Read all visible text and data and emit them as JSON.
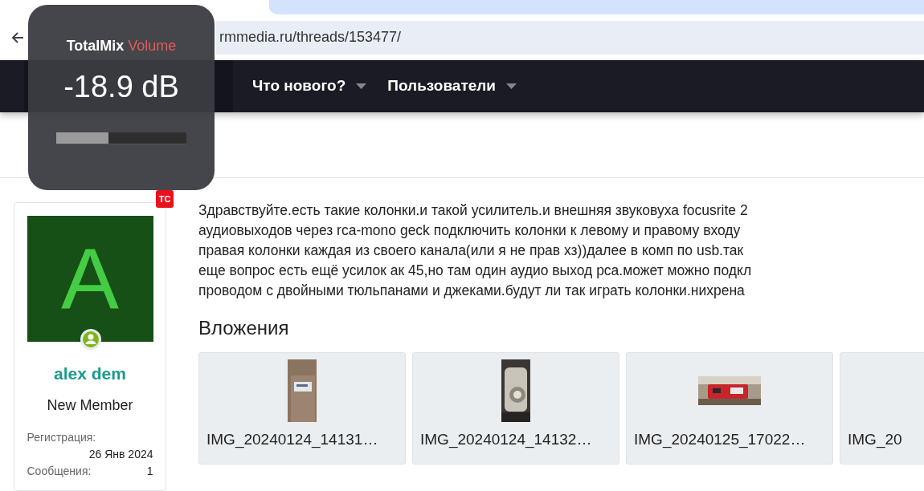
{
  "browser": {
    "address": "rmmedia.ru/threads/153477/"
  },
  "nav": [
    {
      "label": "Что нового?"
    },
    {
      "label": "Пользователи"
    }
  ],
  "overlay": {
    "app": "TotalMix",
    "label": "Volume",
    "reading": "-18.9 dB",
    "level": 0.4
  },
  "user": {
    "badge": "ТС",
    "initial": "A",
    "name": "alex dem",
    "title": "New Member",
    "stats": [
      {
        "label": "Регистрация:",
        "value": "26 Янв 2024"
      },
      {
        "label": "Сообщения:",
        "value": "1"
      }
    ]
  },
  "post": {
    "lines": [
      "Здравствуйте.есть такие колонки.и такой усилитель.и внешняя звуковуха focusrite 2",
      "аудиовыходов через rca-mono geck подключить колонки к левому и правому входу",
      "правая колонки каждая из своего канала(или я не прав хз))далее в комп по usb.так",
      "еще вопрос есть ещё усилок ак 45,но там один аудио выход рса.может можно подкл",
      "проводом с двойными тюльпанами и джеками.будут ли так играть колонки.нихрена"
    ],
    "attachments_heading": "Вложения",
    "attachments": [
      {
        "name": "IMG_20240124_14131…",
        "kind": "picture"
      },
      {
        "name": "IMG_20240124_14132…",
        "kind": "picture"
      },
      {
        "name": "IMG_20240125_17022…",
        "kind": "picture"
      },
      {
        "name": "IMG_20"
      }
    ]
  }
}
